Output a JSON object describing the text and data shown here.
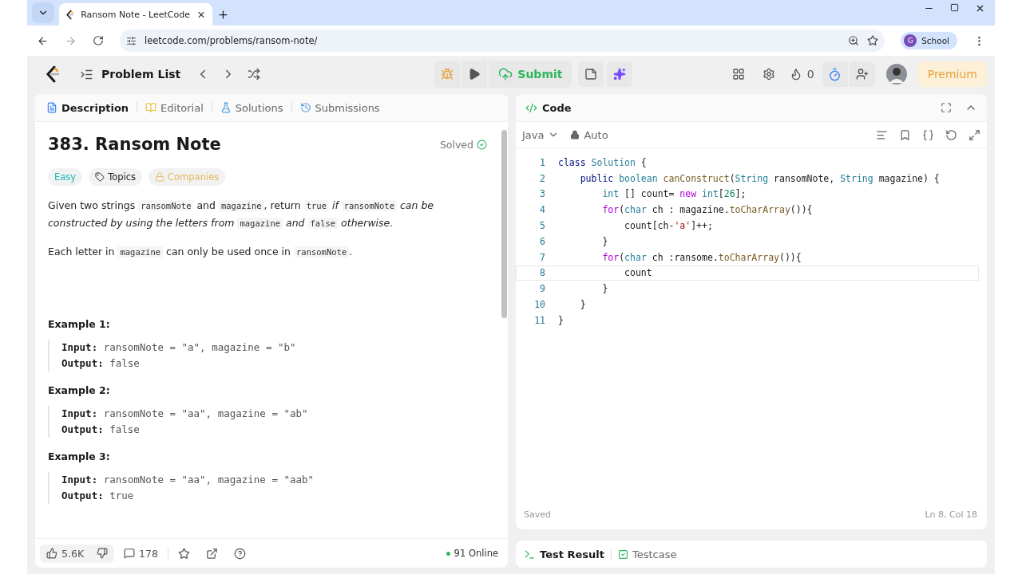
{
  "browser": {
    "tab_title": "Ransom Note - LeetCode",
    "url": "leetcode.com/problems/ransom-note/",
    "profile_initial": "G",
    "profile_name": "School"
  },
  "toolbar": {
    "problem_list": "Problem List",
    "submit": "Submit",
    "streak": "0",
    "premium": "Premium"
  },
  "left_tabs": [
    {
      "label": "Description",
      "selected": true,
      "kind": "doc"
    },
    {
      "label": "Editorial",
      "selected": false,
      "kind": "book"
    },
    {
      "label": "Solutions",
      "selected": false,
      "kind": "flask"
    },
    {
      "label": "Submissions",
      "selected": false,
      "kind": "history"
    }
  ],
  "problem": {
    "title": "383. Ransom Note",
    "status": "Solved",
    "difficulty": "Easy",
    "topics": "Topics",
    "companies": "Companies",
    "paragraphs": [
      [
        {
          "text": "Given two strings ",
          "kind": "text"
        },
        {
          "text": "ransomNote",
          "kind": "code"
        },
        {
          "text": " and ",
          "kind": "text"
        },
        {
          "text": "magazine",
          "kind": "code"
        },
        {
          "text": ", return ",
          "kind": "text"
        },
        {
          "text": "true",
          "kind": "code"
        },
        {
          "text": " if ",
          "kind": "italic"
        },
        {
          "text": "ransomNote",
          "kind": "code"
        },
        {
          "text": " can be constructed by using the letters from ",
          "kind": "italic"
        },
        {
          "text": "magazine",
          "kind": "code"
        },
        {
          "text": " and ",
          "kind": "italic"
        },
        {
          "text": "false",
          "kind": "code"
        },
        {
          "text": " otherwise.",
          "kind": "italic"
        }
      ],
      [
        {
          "text": "Each letter in ",
          "kind": "text"
        },
        {
          "text": "magazine",
          "kind": "code"
        },
        {
          "text": " can only be used once in ",
          "kind": "text"
        },
        {
          "text": "ransomNote",
          "kind": "code"
        },
        {
          "text": ".",
          "kind": "text"
        }
      ]
    ],
    "examples": [
      {
        "title": "Example 1:",
        "input_label": "Input:",
        "input": "ransomNote = \"a\", magazine = \"b\"",
        "output_label": "Output:",
        "output": "false"
      },
      {
        "title": "Example 2:",
        "input_label": "Input:",
        "input": "ransomNote = \"aa\", magazine = \"ab\"",
        "output_label": "Output:",
        "output": "false"
      },
      {
        "title": "Example 3:",
        "input_label": "Input:",
        "input": "ransomNote = \"aa\", magazine = \"aab\"",
        "output_label": "Output:",
        "output": "true"
      }
    ]
  },
  "footer": {
    "likes": "5.6K",
    "comments": "178",
    "online": "91 Online"
  },
  "code_panel": {
    "title": "Code",
    "language": "Java",
    "mode": "Auto",
    "status": "Saved",
    "position": "Ln 8, Col 18",
    "lines": [
      {
        "number": "1",
        "selected": false,
        "tokens": [
          {
            "text": "class ",
            "kind": "kw"
          },
          {
            "text": "Solution",
            "kind": "type"
          },
          {
            "text": " {",
            "kind": "plain"
          }
        ]
      },
      {
        "number": "2",
        "selected": false,
        "tokens": [
          {
            "text": "    public ",
            "kind": "kw"
          },
          {
            "text": "boolean ",
            "kind": "type"
          },
          {
            "text": "canConstruct",
            "kind": "fn"
          },
          {
            "text": "(",
            "kind": "plain"
          },
          {
            "text": "String ",
            "kind": "type"
          },
          {
            "text": "ransomNote, ",
            "kind": "plain"
          },
          {
            "text": "String ",
            "kind": "type"
          },
          {
            "text": "magazine) {",
            "kind": "plain"
          }
        ]
      },
      {
        "number": "3",
        "selected": false,
        "tokens": [
          {
            "text": "        int ",
            "kind": "type"
          },
          {
            "text": "[] count= ",
            "kind": "plain"
          },
          {
            "text": "new ",
            "kind": "ctl"
          },
          {
            "text": "int",
            "kind": "type"
          },
          {
            "text": "[",
            "kind": "plain"
          },
          {
            "text": "26",
            "kind": "num"
          },
          {
            "text": "];",
            "kind": "plain"
          }
        ]
      },
      {
        "number": "4",
        "selected": false,
        "tokens": [
          {
            "text": "        for",
            "kind": "ctl"
          },
          {
            "text": "(",
            "kind": "plain"
          },
          {
            "text": "char ",
            "kind": "type"
          },
          {
            "text": "ch : magazine.",
            "kind": "plain"
          },
          {
            "text": "toCharArray",
            "kind": "fn"
          },
          {
            "text": "()){",
            "kind": "plain"
          }
        ]
      },
      {
        "number": "5",
        "selected": false,
        "tokens": [
          {
            "text": "            count[ch-",
            "kind": "plain"
          },
          {
            "text": "'a'",
            "kind": "str"
          },
          {
            "text": "]++;",
            "kind": "plain"
          }
        ]
      },
      {
        "number": "6",
        "selected": false,
        "tokens": [
          {
            "text": "        }",
            "kind": "plain"
          }
        ]
      },
      {
        "number": "7",
        "selected": false,
        "tokens": [
          {
            "text": "        for",
            "kind": "ctl"
          },
          {
            "text": "(",
            "kind": "plain"
          },
          {
            "text": "char ",
            "kind": "type"
          },
          {
            "text": "ch :ransome.",
            "kind": "plain"
          },
          {
            "text": "toCharArray",
            "kind": "fn"
          },
          {
            "text": "()){",
            "kind": "plain"
          }
        ]
      },
      {
        "number": "8",
        "selected": true,
        "tokens": [
          {
            "text": "            count",
            "kind": "plain"
          }
        ]
      },
      {
        "number": "9",
        "selected": false,
        "tokens": [
          {
            "text": "        }",
            "kind": "plain"
          }
        ]
      },
      {
        "number": "10",
        "selected": false,
        "tokens": [
          {
            "text": "    }",
            "kind": "plain"
          }
        ]
      },
      {
        "number": "11",
        "selected": false,
        "tokens": [
          {
            "text": "}",
            "kind": "plain"
          }
        ]
      }
    ]
  },
  "bottom_tabs": [
    {
      "label": "Test Result",
      "selected": true,
      "kind": "terminal"
    },
    {
      "label": "Testcase",
      "selected": false,
      "kind": "check"
    }
  ]
}
